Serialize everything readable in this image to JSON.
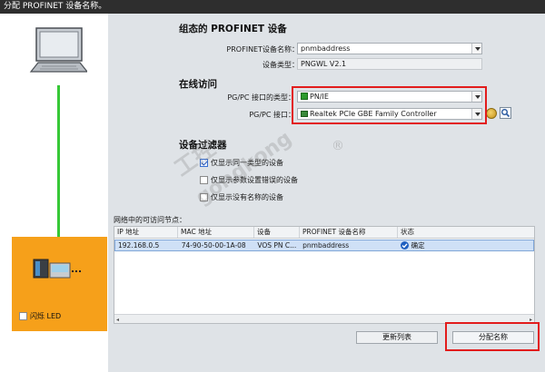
{
  "window": {
    "title": "分配 PROFINET 设备名称。"
  },
  "configured": {
    "heading": "组态的 PROFINET 设备",
    "device_name_label": "PROFINET设备名称：",
    "device_name_value": "pnmbaddress",
    "device_type_label": "设备类型：",
    "device_type_value": "PNGWL V2.1"
  },
  "online_access": {
    "heading": "在线访问",
    "interface_type_label": "PG/PC 接口的类型：",
    "interface_type_value": "PN/IE",
    "interface_label": "PG/PC 接口：",
    "interface_value": "Realtek PCIe GBE Family Controller"
  },
  "filter": {
    "heading": "设备过滤器",
    "options": [
      {
        "label": "仅显示同一类型的设备",
        "checked": true
      },
      {
        "label": "仅显示参数设置错误的设备",
        "checked": false
      },
      {
        "label": "仅显示没有名称的设备",
        "checked": false
      }
    ]
  },
  "watermark": {
    "line1": "工控",
    "line2": "gongkong",
    "registered": "®"
  },
  "nodes": {
    "caption": "网络中的可访问节点：",
    "columns": [
      "IP 地址",
      "MAC 地址",
      "设备",
      "PROFINET 设备名称",
      "状态"
    ],
    "rows": [
      {
        "ip": "192.168.0.5",
        "mac": "74-90-50-00-1A-08",
        "device": "VOS PN C...",
        "name": "pnmbaddress",
        "status": "确定"
      }
    ]
  },
  "left": {
    "flash_led_label": "闪烁 LED"
  },
  "buttons": {
    "refresh": "更新列表",
    "assign": "分配名称"
  },
  "colors": {
    "accent_red": "#e21c1c",
    "link_green": "#36c836",
    "device_orange": "#f6a01a"
  }
}
